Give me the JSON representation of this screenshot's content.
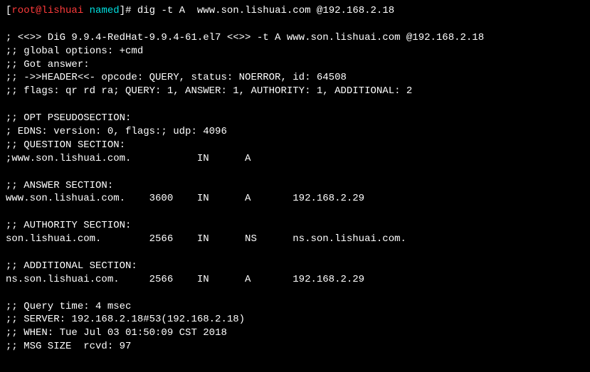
{
  "prompt": {
    "bracket_open": "[",
    "user": "root@lishuai",
    "sep": " ",
    "dir": "named",
    "bracket_close": "]",
    "hash": "# ",
    "command": "dig -t A  www.son.lishuai.com @192.168.2.18"
  },
  "output": {
    "blank1": " ",
    "version": "; <<>> DiG 9.9.4-RedHat-9.9.4-61.el7 <<>> -t A www.son.lishuai.com @192.168.2.18",
    "global_options": ";; global options: +cmd",
    "got_answer": ";; Got answer:",
    "header": ";; ->>HEADER<<- opcode: QUERY, status: NOERROR, id: 64508",
    "flags": ";; flags: qr rd ra; QUERY: 1, ANSWER: 1, AUTHORITY: 1, ADDITIONAL: 2",
    "blank2": " ",
    "opt_header": ";; OPT PSEUDOSECTION:",
    "edns": "; EDNS: version: 0, flags:; udp: 4096",
    "question_header": ";; QUESTION SECTION:",
    "question_line": ";www.son.lishuai.com.           IN      A",
    "blank3": " ",
    "answer_header": ";; ANSWER SECTION:",
    "answer_line": "www.son.lishuai.com.    3600    IN      A       192.168.2.29",
    "blank4": " ",
    "authority_header": ";; AUTHORITY SECTION:",
    "authority_line": "son.lishuai.com.        2566    IN      NS      ns.son.lishuai.com.",
    "blank5": " ",
    "additional_header": ";; ADDITIONAL SECTION:",
    "additional_line": "ns.son.lishuai.com.     2566    IN      A       192.168.2.29",
    "blank6": " ",
    "query_time": ";; Query time: 4 msec",
    "server": ";; SERVER: 192.168.2.18#53(192.168.2.18)",
    "when": ";; WHEN: Tue Jul 03 01:50:09 CST 2018",
    "msg_size": ";; MSG SIZE  rcvd: 97"
  }
}
